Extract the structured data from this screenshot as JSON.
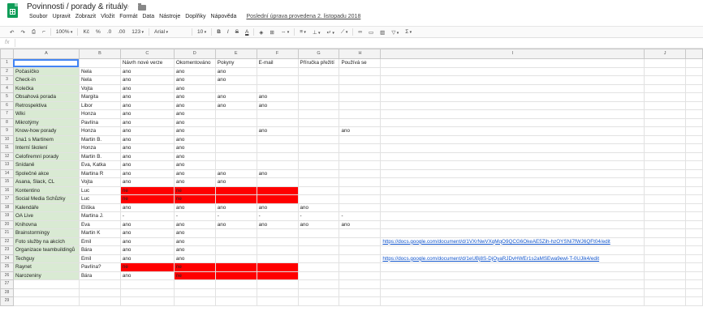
{
  "title_bar": {
    "doc_title": "Povinnosti / porady & rituály",
    "menus": [
      "Soubor",
      "Upravit",
      "Zobrazit",
      "Vložit",
      "Formát",
      "Data",
      "Nástroje",
      "Doplňky",
      "Nápověda"
    ],
    "last_edit": "Poslední úprava provedena 2. listopadu 2018"
  },
  "toolbar": {
    "zoom": "100%",
    "currency": "Kč",
    "percent": "%",
    "dec_less": ".0",
    "dec_more": ".00",
    "format_more": "123",
    "font": "Arial",
    "font_size": "10",
    "bold": "B",
    "italic": "I",
    "strike": "S",
    "text_color": "A",
    "sigma": "Σ"
  },
  "formula_bar": {
    "fx": "fx",
    "value": ""
  },
  "grid": {
    "columns": [
      "A",
      "B",
      "C",
      "D",
      "E",
      "F",
      "G",
      "H",
      "I",
      "J"
    ],
    "header_row": [
      "",
      "",
      "Návrh nové verze",
      "Okomentováno",
      "Pokyny",
      "E-mail",
      "Příručka přežití",
      "Používá se",
      "",
      ""
    ],
    "rows": [
      {
        "n": "2",
        "cells": [
          "Počasíčko",
          "Nela",
          "ano",
          "ano",
          "ano",
          "",
          "",
          "",
          "",
          ""
        ]
      },
      {
        "n": "3",
        "cells": [
          "Check-in",
          "Nela",
          "ano",
          "ano",
          "ano",
          "",
          "",
          "",
          "",
          ""
        ]
      },
      {
        "n": "4",
        "cells": [
          "Kolečka",
          "Vojta",
          "ano",
          "ano",
          "",
          "",
          "",
          "",
          "",
          ""
        ]
      },
      {
        "n": "5",
        "cells": [
          "Obsahová porada",
          "Margita",
          "ano",
          "ano",
          "ano",
          "ano",
          "",
          "",
          "",
          ""
        ]
      },
      {
        "n": "6",
        "cells": [
          "Retrospektiva",
          "Libor",
          "ano",
          "ano",
          "ano",
          "ano",
          "",
          "",
          "",
          ""
        ]
      },
      {
        "n": "7",
        "cells": [
          "Wiki",
          "Honza",
          "ano",
          "ano",
          "",
          "",
          "",
          "",
          "",
          ""
        ]
      },
      {
        "n": "8",
        "cells": [
          "Mikrotýmy",
          "Pavlína",
          "ano",
          "ano",
          "",
          "",
          "",
          "",
          "",
          ""
        ]
      },
      {
        "n": "9",
        "cells": [
          "Know-how porady",
          "Honza",
          "ano",
          "ano",
          "",
          "ano",
          "",
          "ano",
          "",
          ""
        ]
      },
      {
        "n": "10",
        "cells": [
          "1na1 s Martinem",
          "Martin B.",
          "ano",
          "ano",
          "",
          "",
          "",
          "",
          "",
          ""
        ]
      },
      {
        "n": "11",
        "cells": [
          "Interní školení",
          "Honza",
          "ano",
          "ano",
          "",
          "",
          "",
          "",
          "",
          ""
        ]
      },
      {
        "n": "12",
        "cells": [
          "Celofiremní porady",
          "Martin B.",
          "ano",
          "ano",
          "",
          "",
          "",
          "",
          "",
          ""
        ]
      },
      {
        "n": "13",
        "cells": [
          "Snídaně",
          "Eva, Katka",
          "ano",
          "ano",
          "",
          "",
          "",
          "",
          "",
          ""
        ]
      },
      {
        "n": "14",
        "cells": [
          "Společné akce",
          "Martina R",
          "ano",
          "ano",
          "ano",
          "ano",
          "",
          "",
          "",
          ""
        ]
      },
      {
        "n": "15",
        "cells": [
          "Asana, Slack, CL",
          "Vojta",
          "ano",
          "ano",
          "ano",
          "",
          "",
          "",
          "",
          ""
        ]
      },
      {
        "n": "16",
        "cells": [
          "Kontentino",
          "Luc",
          "ne",
          "ne",
          "",
          "",
          "",
          "",
          "",
          ""
        ],
        "red": [
          2,
          3,
          4,
          5
        ]
      },
      {
        "n": "17",
        "cells": [
          "Social Media Schůzky",
          "Luc",
          "ne",
          "ne",
          "",
          "",
          "",
          "",
          "",
          ""
        ],
        "red": [
          2,
          3,
          4,
          5
        ]
      },
      {
        "n": "18",
        "cells": [
          "Kalendáře",
          "Eliška",
          "ano",
          "ano",
          "ano",
          "ano",
          "ano",
          "",
          "",
          ""
        ]
      },
      {
        "n": "19",
        "cells": [
          "OA Live",
          "Martina J.",
          "-",
          "-",
          "-",
          "-",
          "-",
          "-",
          "",
          ""
        ]
      },
      {
        "n": "20",
        "cells": [
          "Knihovna",
          "Eva",
          "ano",
          "ano",
          "ano",
          "ano",
          "ano",
          "ano",
          "",
          ""
        ]
      },
      {
        "n": "21",
        "cells": [
          "Brainstormingy",
          "Martin K",
          "ano",
          "ano",
          "",
          "",
          "",
          "",
          "",
          ""
        ]
      },
      {
        "n": "22",
        "cells": [
          "Foto služby na akcích",
          "Emil",
          "ano",
          "ano",
          "",
          "",
          "",
          "",
          "https://docs.google.com/document/d/1VXrNwVXqMqO9QCG6OkeAE5Zih-hzOYSNi7fWJ6QFt04/edit",
          ""
        ],
        "link": 8
      },
      {
        "n": "23",
        "cells": [
          "Organizace teambuildingů",
          "Bára",
          "ano",
          "ano",
          "",
          "",
          "",
          "",
          "",
          ""
        ]
      },
      {
        "n": "24",
        "cells": [
          "Techguy",
          "Emil",
          "ano",
          "ano",
          "",
          "",
          "",
          "",
          "https://docs.google.com/document/d/1eUBj8S-DjOyaRJDvHWEr1s2aMSEwa9ewl-T-0UJik4/edit",
          ""
        ],
        "link": 8
      },
      {
        "n": "25",
        "cells": [
          "Raynet",
          "Pavlína?",
          "ne",
          "ne",
          "",
          "",
          "",
          "",
          "",
          ""
        ],
        "red": [
          2,
          3,
          4,
          5
        ]
      },
      {
        "n": "26",
        "cells": [
          "Narozeniny",
          "Bára",
          "ano",
          "ne",
          "",
          "",
          "",
          "",
          "",
          ""
        ],
        "red": [
          3,
          4,
          5
        ]
      },
      {
        "n": "27",
        "cells": [
          "",
          "",
          "",
          "",
          "",
          "",
          "",
          "",
          "",
          ""
        ]
      },
      {
        "n": "28",
        "cells": [
          "",
          "",
          "",
          "",
          "",
          "",
          "",
          "",
          "",
          ""
        ]
      },
      {
        "n": "29",
        "cells": [
          "",
          "",
          "",
          "",
          "",
          "",
          "",
          "",
          "",
          ""
        ]
      }
    ]
  },
  "colors": {
    "brand_green": "#0f9d58",
    "name_column_bg": "#d9ead3",
    "alert_red": "#ff0000",
    "link_blue": "#1155cc",
    "selection_blue": "#4285f4"
  }
}
